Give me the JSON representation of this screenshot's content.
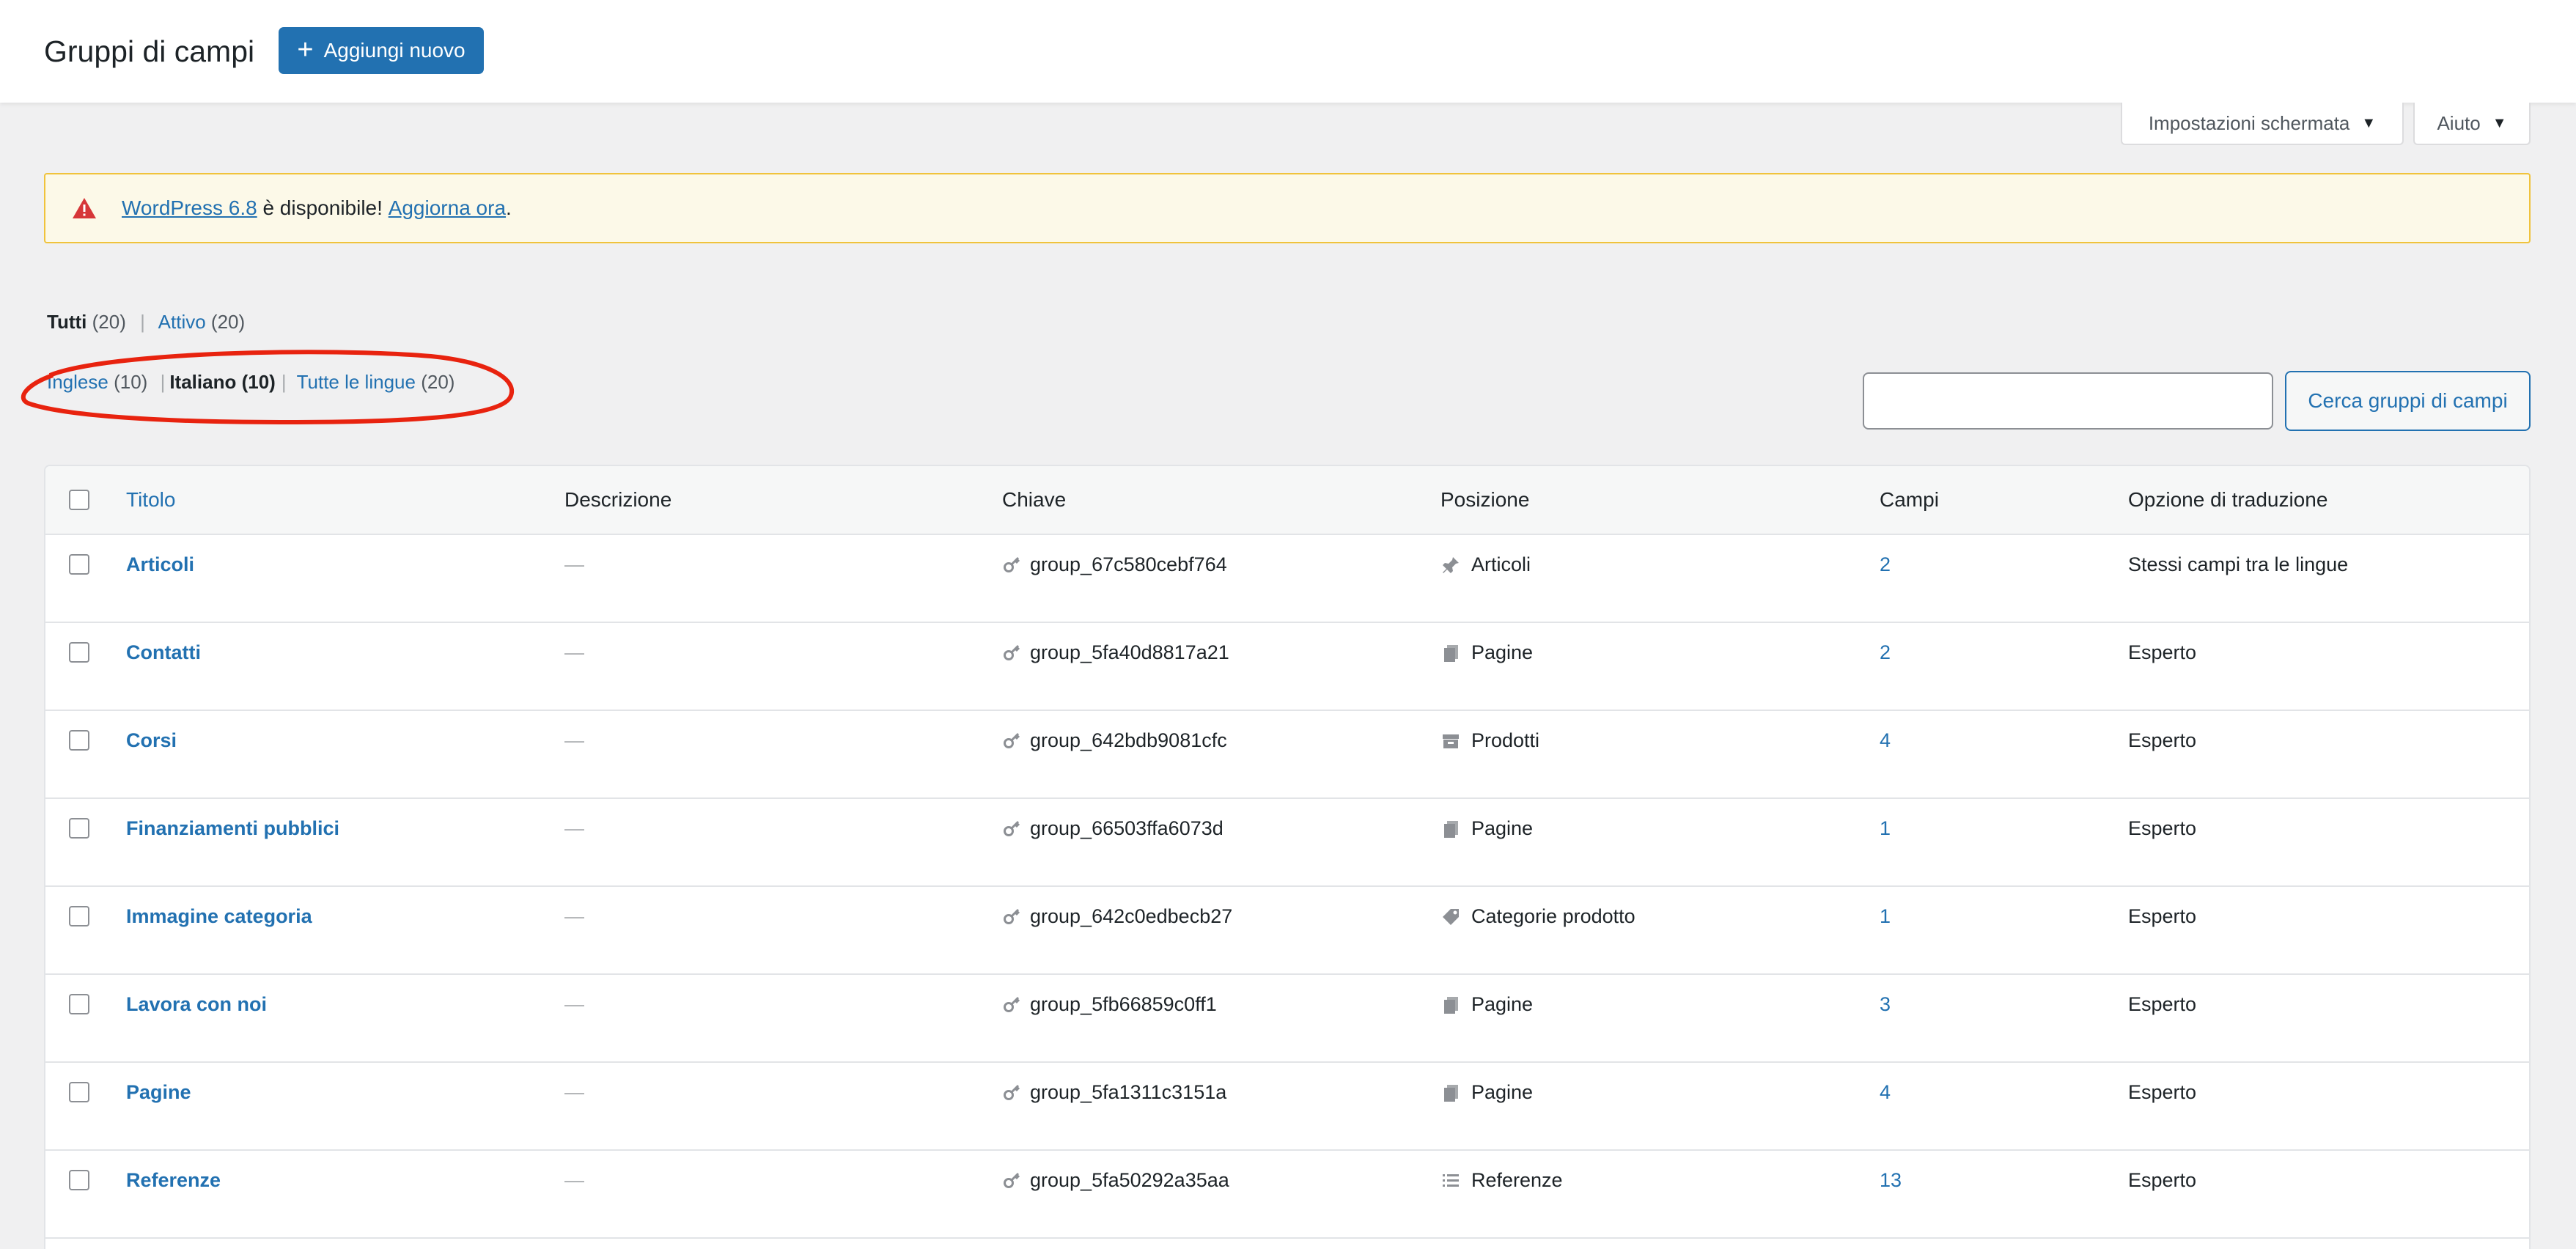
{
  "header": {
    "title": "Gruppi di campi",
    "add_new_label": "Aggiungi nuovo"
  },
  "screen_meta": {
    "screen_options_label": "Impostazioni schermata",
    "help_label": "Aiuto"
  },
  "notice": {
    "version_link": "WordPress 6.8",
    "middle_text": " è disponibile! ",
    "update_link": "Aggiorna ora",
    "end_text": ".",
    "icon": "warning-icon",
    "color": "#f0c33c"
  },
  "status_filters": [
    {
      "label": "Tutti",
      "count": "(20)",
      "current": true
    },
    {
      "label": "Attivo",
      "count": "(20)",
      "current": false
    }
  ],
  "language_filters": [
    {
      "label": "Inglese",
      "count": "(10)",
      "current": false
    },
    {
      "label": "Italiano",
      "count": "(10)",
      "current": true
    },
    {
      "label": "Tutte le lingue",
      "count": "(20)",
      "current": false
    }
  ],
  "annotation": {
    "color": "#e8230f"
  },
  "search": {
    "placeholder": "",
    "button_label": "Cerca gruppi di campi"
  },
  "table": {
    "columns": {
      "title": "Titolo",
      "description": "Descrizione",
      "key": "Chiave",
      "position": "Posizione",
      "fields": "Campi",
      "translation": "Opzione di traduzione"
    },
    "rows": [
      {
        "title": "Articoli",
        "description": "—",
        "key": "group_67c580cebf764",
        "position": "Articoli",
        "position_icon": "pin-icon",
        "fields": "2",
        "translation": "Stessi campi tra le lingue"
      },
      {
        "title": "Contatti",
        "description": "—",
        "key": "group_5fa40d8817a21",
        "position": "Pagine",
        "position_icon": "pages-icon",
        "fields": "2",
        "translation": "Esperto"
      },
      {
        "title": "Corsi",
        "description": "—",
        "key": "group_642bdb9081cfc",
        "position": "Prodotti",
        "position_icon": "archive-icon",
        "fields": "4",
        "translation": "Esperto"
      },
      {
        "title": "Finanziamenti pubblici",
        "description": "—",
        "key": "group_66503ffa6073d",
        "position": "Pagine",
        "position_icon": "pages-icon",
        "fields": "1",
        "translation": "Esperto"
      },
      {
        "title": "Immagine categoria",
        "description": "—",
        "key": "group_642c0edbecb27",
        "position": "Categorie prodotto",
        "position_icon": "tag-icon",
        "fields": "1",
        "translation": "Esperto"
      },
      {
        "title": "Lavora con noi",
        "description": "—",
        "key": "group_5fb66859c0ff1",
        "position": "Pagine",
        "position_icon": "pages-icon",
        "fields": "3",
        "translation": "Esperto"
      },
      {
        "title": "Pagine",
        "description": "—",
        "key": "group_5fa1311c3151a",
        "position": "Pagine",
        "position_icon": "pages-icon",
        "fields": "4",
        "translation": "Esperto"
      },
      {
        "title": "Referenze",
        "description": "—",
        "key": "group_5fa50292a35aa",
        "position": "Referenze",
        "position_icon": "list-icon",
        "fields": "13",
        "translation": "Esperto"
      }
    ]
  }
}
